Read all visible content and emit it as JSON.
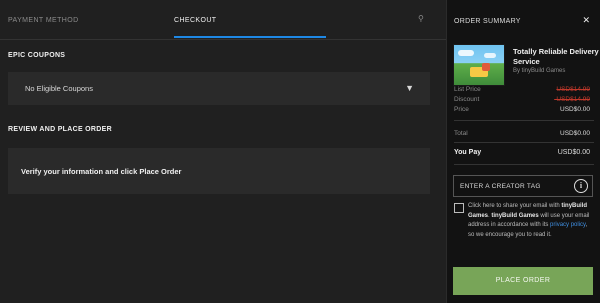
{
  "tabs": [
    {
      "label": "PAYMENT METHOD"
    },
    {
      "label": "CHECKOUT"
    }
  ],
  "tab_extra_icon": "pin-icon",
  "coupons": {
    "title": "EPIC COUPONS",
    "selected": "No Eligible Coupons"
  },
  "review": {
    "title": "REVIEW AND PLACE ORDER",
    "message": "Verify your information and click Place Order"
  },
  "order_summary": {
    "title": "ORDER SUMMARY",
    "game_name": "Totally Reliable Delivery Service",
    "publisher": "By tinyBuild Games",
    "list_price_label": "List Price",
    "list_price_value": "USD$14.99",
    "discount_label": "Discount",
    "discount_value": "-USD$14.99",
    "price_label": "Price",
    "price_value": "USD$0.00",
    "total_label": "Total",
    "total_value": "USD$0.00",
    "you_pay_label": "You Pay",
    "you_pay_value": "USD$0.00",
    "creator_tag_placeholder": "ENTER A CREATOR TAG",
    "share": {
      "text_1": "Click here to share your email with ",
      "bold_1": "tinyBuild Games",
      "text_2": ". ",
      "bold_2": "tinyBuild Games",
      "text_3": " will use your email address in accordance with its ",
      "link": "privacy policy",
      "text_4": ", so we encourage you to read it."
    },
    "place_order_label": "PLACE ORDER"
  },
  "colors": {
    "accent_blue": "#1e88e5",
    "place_order_green": "#78a558",
    "strike_red": "#c0392b",
    "link_blue": "#3f8ee0"
  }
}
